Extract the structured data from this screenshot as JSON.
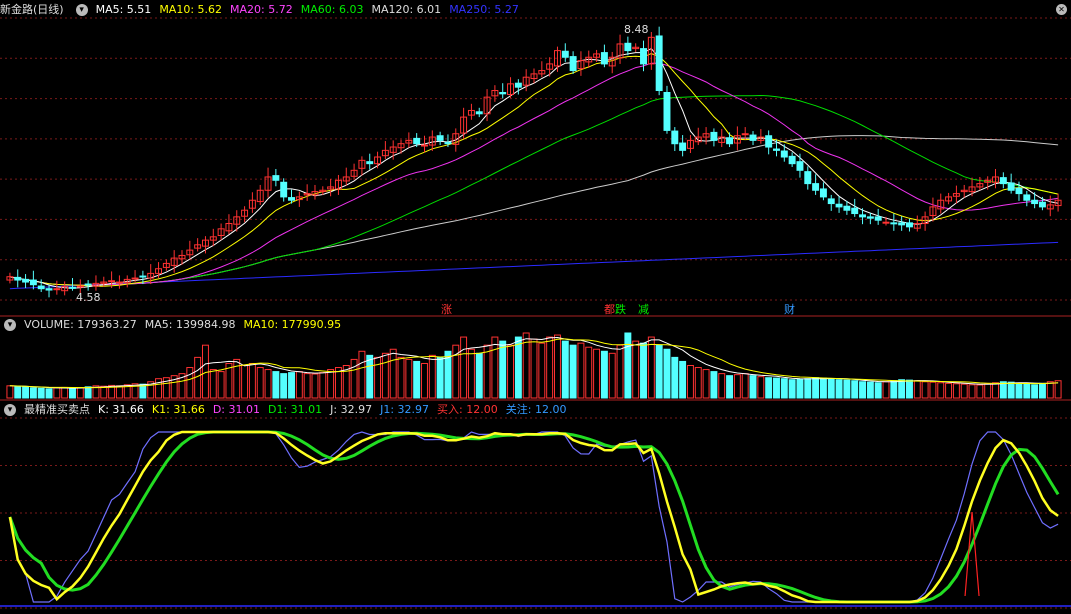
{
  "main_header": {
    "stock": "新金路",
    "period": "(日线)",
    "items": [
      {
        "label": "MA5: 5.51",
        "color": "#ffffff"
      },
      {
        "label": "MA10: 5.62",
        "color": "#ffff00"
      },
      {
        "label": "MA20: 5.72",
        "color": "#ff44ff"
      },
      {
        "label": "MA60: 6.03",
        "color": "#00ee00"
      },
      {
        "label": "MA120: 6.01",
        "color": "#dddddd"
      },
      {
        "label": "MA250: 5.27",
        "color": "#3333ff"
      }
    ]
  },
  "volume_header": {
    "items": [
      {
        "label": "VOLUME: 179363.27",
        "color": "#dddddd"
      },
      {
        "label": "MA5: 139984.98",
        "color": "#dddddd"
      },
      {
        "label": "MA10: 177990.95",
        "color": "#ffff00"
      }
    ]
  },
  "kd_header": {
    "name": "最精准买卖点",
    "items": [
      {
        "label": "K: 31.66",
        "color": "#ffffff"
      },
      {
        "label": "K1: 31.66",
        "color": "#ffff00"
      },
      {
        "label": "D: 31.01",
        "color": "#ff44ff"
      },
      {
        "label": "D1: 31.01",
        "color": "#00ee00"
      },
      {
        "label": "J: 32.97",
        "color": "#dddddd"
      },
      {
        "label": "J1: 32.97",
        "color": "#3399ff"
      },
      {
        "label": "买入: 12.00",
        "color": "#ff3333"
      },
      {
        "label": "关注: 12.00",
        "color": "#3399ff"
      }
    ]
  },
  "events": [
    {
      "text": "涨",
      "color": "#ff3333"
    },
    {
      "text": "都",
      "color": "#ff3333"
    },
    {
      "text": "跌",
      "color": "#00ee00"
    },
    {
      "text": "减",
      "color": "#00ee00"
    },
    {
      "text": "财",
      "color": "#3399ff"
    }
  ],
  "icons": {
    "panel_toggle": "chevron-down-icon",
    "window_close": "close-icon"
  },
  "chart_data": {
    "type": "candlestick",
    "price_labels": {
      "high": "8.48",
      "low": "4.58"
    },
    "price_high": 8.48,
    "price_low": 4.58,
    "closes": [
      4.8,
      4.75,
      4.72,
      4.68,
      4.62,
      4.6,
      4.62,
      4.65,
      4.64,
      4.66,
      4.68,
      4.7,
      4.72,
      4.74,
      4.72,
      4.76,
      4.78,
      4.8,
      4.85,
      4.92,
      5.0,
      5.08,
      5.12,
      5.2,
      5.28,
      5.35,
      5.4,
      5.52,
      5.6,
      5.7,
      5.8,
      5.95,
      6.1,
      6.3,
      6.25,
      6.0,
      5.95,
      6.0,
      6.05,
      6.08,
      6.1,
      6.15,
      6.25,
      6.3,
      6.4,
      6.55,
      6.5,
      6.6,
      6.7,
      6.75,
      6.8,
      6.85,
      6.8,
      6.78,
      6.9,
      6.85,
      6.8,
      6.95,
      7.2,
      7.3,
      7.25,
      7.5,
      7.6,
      7.55,
      7.7,
      7.65,
      7.8,
      7.85,
      7.9,
      8.0,
      8.2,
      8.1,
      7.9,
      8.05,
      8.1,
      8.15,
      8.0,
      8.1,
      8.3,
      8.2,
      8.25,
      8.0,
      8.4,
      7.6,
      7.0,
      6.8,
      6.7,
      6.85,
      6.9,
      6.95,
      6.85,
      6.9,
      6.8,
      6.92,
      6.95,
      6.85,
      6.9,
      6.75,
      6.7,
      6.6,
      6.5,
      6.4,
      6.2,
      6.1,
      6.0,
      5.9,
      5.85,
      5.8,
      5.75,
      5.7,
      5.68,
      5.65,
      5.62,
      5.6,
      5.58,
      5.55,
      5.6,
      5.7,
      5.85,
      5.95,
      6.0,
      6.05,
      6.1,
      6.15,
      6.2,
      6.25,
      6.3,
      6.2,
      6.1,
      6.05,
      5.95,
      5.9,
      5.85,
      5.88,
      5.95
    ],
    "volumes": [
      60,
      58,
      55,
      50,
      48,
      45,
      50,
      52,
      48,
      50,
      55,
      60,
      58,
      62,
      60,
      65,
      70,
      68,
      80,
      95,
      100,
      110,
      120,
      150,
      200,
      260,
      140,
      130,
      170,
      190,
      160,
      170,
      150,
      140,
      130,
      120,
      125,
      130,
      120,
      118,
      125,
      140,
      150,
      160,
      190,
      230,
      210,
      200,
      220,
      240,
      200,
      190,
      180,
      170,
      210,
      200,
      230,
      260,
      300,
      240,
      220,
      260,
      300,
      280,
      260,
      300,
      320,
      290,
      270,
      300,
      310,
      280,
      260,
      270,
      250,
      240,
      230,
      220,
      260,
      320,
      280,
      270,
      300,
      260,
      240,
      200,
      180,
      160,
      150,
      140,
      130,
      120,
      110,
      115,
      120,
      110,
      105,
      100,
      98,
      95,
      90,
      92,
      95,
      100,
      98,
      96,
      90,
      88,
      85,
      80,
      78,
      75,
      80,
      85,
      90,
      88,
      85,
      80,
      78,
      75,
      72,
      70,
      68,
      65,
      64,
      70,
      75,
      80,
      78,
      74,
      70,
      65,
      72,
      80,
      85
    ]
  }
}
